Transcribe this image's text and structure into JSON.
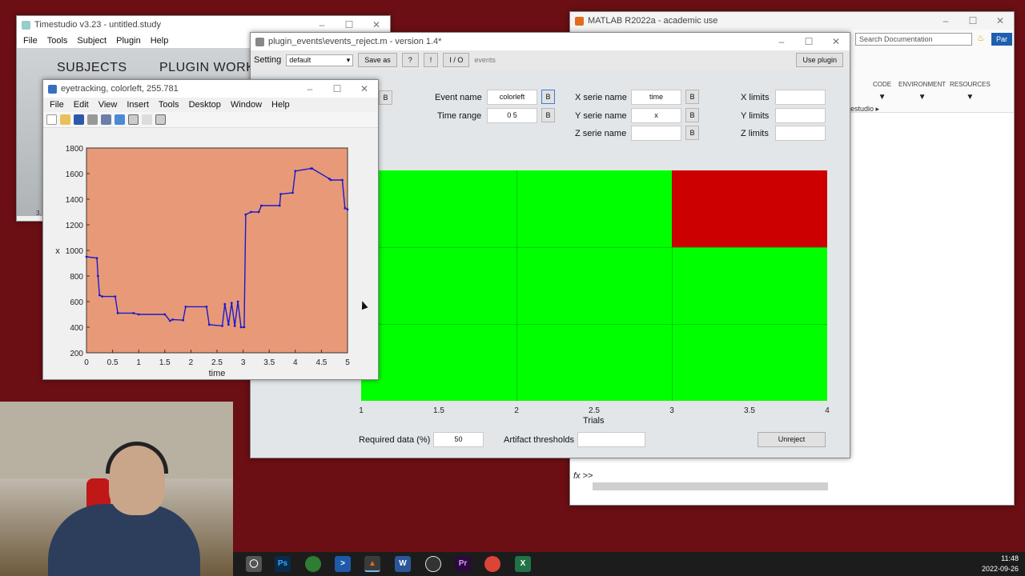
{
  "timestudio": {
    "title": "Timestudio v3.23 - untitled.study",
    "menu": [
      "File",
      "Tools",
      "Subject",
      "Plugin",
      "Help"
    ],
    "heading_subjects": "SUBJECTS",
    "heading_plugin": "PLUGIN WORK",
    "status": "3."
  },
  "matlab": {
    "title": "MATLAB R2022a - academic use",
    "search_placeholder": "Search Documentation",
    "user": "Par",
    "sections": [
      "CODE",
      "ENVIRONMENT",
      "RESOURCES"
    ],
    "path": "estudio",
    "prompt": ">>"
  },
  "plugin": {
    "title": "plugin_events\\events_reject.m - version 1.4*",
    "setting_label": "Setting",
    "setting_value": "default",
    "save_as": "Save as",
    "help_q": "?",
    "help_bang": "!",
    "io": "I / O",
    "io_events": "events",
    "use_plugin": "Use plugin",
    "event_name_label": "Event name",
    "event_name_value": "colorleft",
    "time_range_label": "Time range",
    "time_range_value": "0 5",
    "x_serie_label": "X serie name",
    "x_serie_value": "time",
    "y_serie_label": "Y serie name",
    "y_serie_value": "x",
    "z_serie_label": "Z serie name",
    "z_serie_value": "",
    "x_limits_label": "X limits",
    "y_limits_label": "Y limits",
    "z_limits_label": "Z limits",
    "b_label": "B",
    "required_label": "Required data (%)",
    "required_value": "50",
    "artifact_label": "Artifact thresholds",
    "artifact_value": "",
    "unreject": "Unreject",
    "grid": {
      "xlabel": "Trials",
      "xticks": [
        "1",
        "1.5",
        "2",
        "2.5",
        "3",
        "3.5",
        "4"
      ],
      "cell_colors": {
        "ok": "#00ff00",
        "reject": "#cc0000"
      }
    }
  },
  "figure": {
    "title": "eyetracking, colorleft, 255.781",
    "menu": [
      "File",
      "Edit",
      "View",
      "Insert",
      "Tools",
      "Desktop",
      "Window",
      "Help"
    ]
  },
  "chart_data": {
    "type": "line",
    "xlabel": "time",
    "ylabel": "x",
    "xlim": [
      0,
      5
    ],
    "ylim": [
      200,
      1800
    ],
    "xticks": [
      "0",
      "0.5",
      "1",
      "1.5",
      "2",
      "2.5",
      "3",
      "3.5",
      "4",
      "4.5",
      "5"
    ],
    "yticks": [
      "200",
      "400",
      "600",
      "800",
      "1000",
      "1200",
      "1400",
      "1600",
      "1800"
    ],
    "background": "#e89a78",
    "series": [
      {
        "color": "#1a1acc",
        "x": [
          0,
          0.2,
          0.22,
          0.25,
          0.3,
          0.55,
          0.6,
          0.9,
          1.0,
          1.5,
          1.6,
          1.65,
          1.85,
          1.9,
          2.3,
          2.35,
          2.6,
          2.65,
          2.72,
          2.78,
          2.84,
          2.9,
          2.96,
          3.02,
          3.05,
          3.15,
          3.3,
          3.35,
          3.7,
          3.72,
          3.95,
          4.0,
          4.3,
          4.32,
          4.65,
          4.68,
          4.9,
          4.95,
          5.0
        ],
        "y": [
          950,
          940,
          800,
          650,
          640,
          640,
          510,
          510,
          500,
          500,
          450,
          460,
          455,
          560,
          560,
          420,
          410,
          580,
          420,
          590,
          410,
          600,
          400,
          400,
          1280,
          1300,
          1300,
          1350,
          1350,
          1440,
          1450,
          1620,
          1640,
          1640,
          1560,
          1550,
          1550,
          1330,
          1320
        ]
      }
    ]
  },
  "taskbar": {
    "time": "11:48",
    "date": "2022-09-26",
    "apps": [
      "unity-icon",
      "photoshop-icon",
      "earth-icon",
      "powershell-icon",
      "matlab-icon",
      "word-icon",
      "obs-icon",
      "premiere-icon",
      "chrome-icon",
      "excel-icon"
    ]
  }
}
